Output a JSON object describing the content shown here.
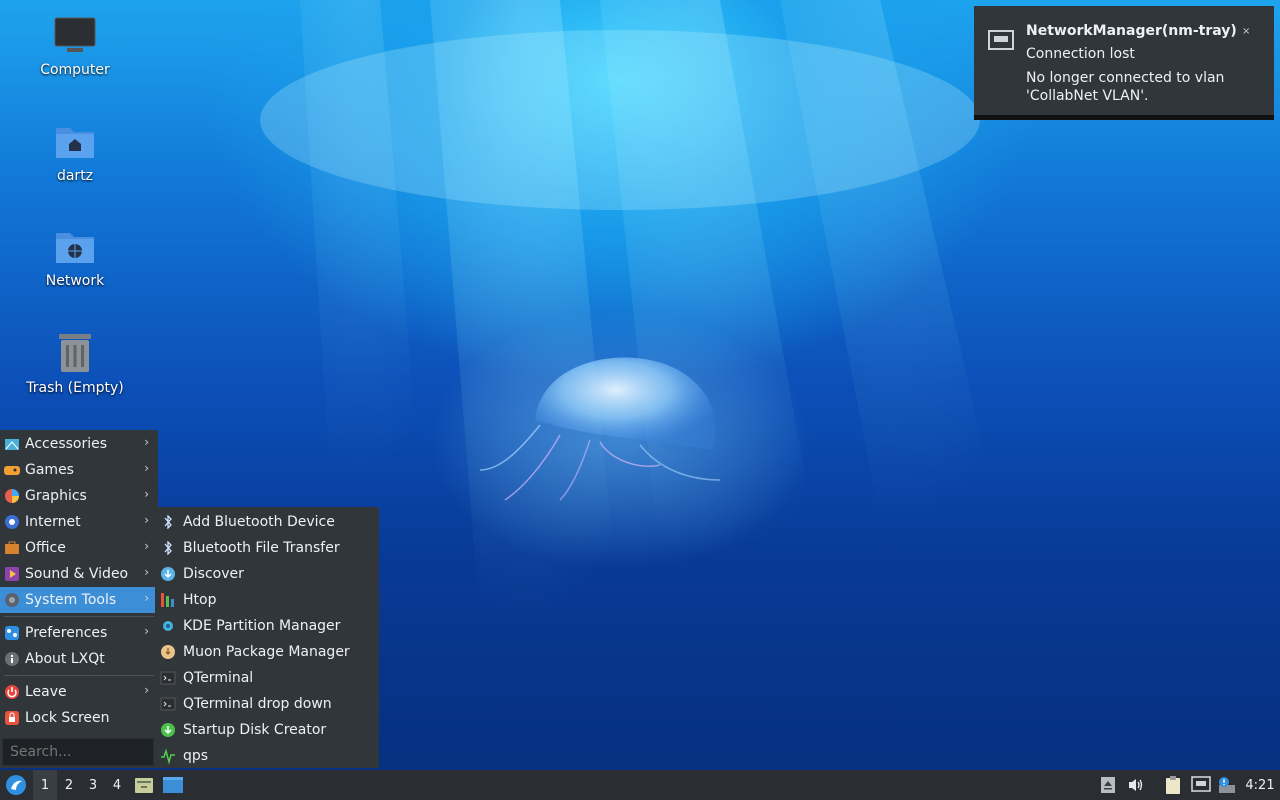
{
  "desktop": {
    "icons": [
      {
        "label": "Computer",
        "icon": "monitor-icon"
      },
      {
        "label": "dartz",
        "icon": "home-folder-icon"
      },
      {
        "label": "Network",
        "icon": "network-folder-icon"
      },
      {
        "label": "Trash (Empty)",
        "icon": "trash-icon"
      }
    ]
  },
  "notification": {
    "title": "NetworkManager(nm-tray)",
    "summary": "Connection lost",
    "body": "No longer connected to vlan 'CollabNet VLAN'.",
    "close": "×",
    "icon": "network-wired-icon"
  },
  "menu": {
    "items": [
      {
        "label": "Accessories",
        "icon": "accessories-icon",
        "arrow": "›"
      },
      {
        "label": "Games",
        "icon": "games-icon",
        "arrow": "›"
      },
      {
        "label": "Graphics",
        "icon": "graphics-icon",
        "arrow": "›"
      },
      {
        "label": "Internet",
        "icon": "internet-icon",
        "arrow": "›"
      },
      {
        "label": "Office",
        "icon": "office-icon",
        "arrow": "›"
      },
      {
        "label": "Sound & Video",
        "icon": "sound-video-icon",
        "arrow": "›"
      },
      {
        "label": "System Tools",
        "icon": "system-tools-icon",
        "arrow": "›"
      },
      {
        "label": "Preferences",
        "icon": "preferences-icon",
        "arrow": "›"
      },
      {
        "label": "About LXQt",
        "icon": "info-icon"
      },
      {
        "label": "Leave",
        "icon": "power-icon",
        "arrow": "›"
      },
      {
        "label": "Lock Screen",
        "icon": "lock-icon"
      }
    ],
    "search_placeholder": "Search...",
    "accent_color": "#3c8fd6"
  },
  "submenu": {
    "items": [
      {
        "label": "Add Bluetooth Device",
        "icon": "bluetooth-icon"
      },
      {
        "label": "Bluetooth File Transfer",
        "icon": "bluetooth-icon"
      },
      {
        "label": "Discover",
        "icon": "discover-icon"
      },
      {
        "label": "Htop",
        "icon": "htop-icon"
      },
      {
        "label": "KDE Partition Manager",
        "icon": "partition-manager-icon"
      },
      {
        "label": "Muon Package Manager",
        "icon": "package-manager-icon"
      },
      {
        "label": "QTerminal",
        "icon": "terminal-icon"
      },
      {
        "label": "QTerminal drop down",
        "icon": "terminal-icon"
      },
      {
        "label": "Startup Disk Creator",
        "icon": "usb-creator-icon"
      },
      {
        "label": "qps",
        "icon": "process-monitor-icon"
      }
    ]
  },
  "taskbar": {
    "desktops": [
      "1",
      "2",
      "3",
      "4"
    ],
    "active_desktop": "1",
    "clock": "4:21"
  }
}
